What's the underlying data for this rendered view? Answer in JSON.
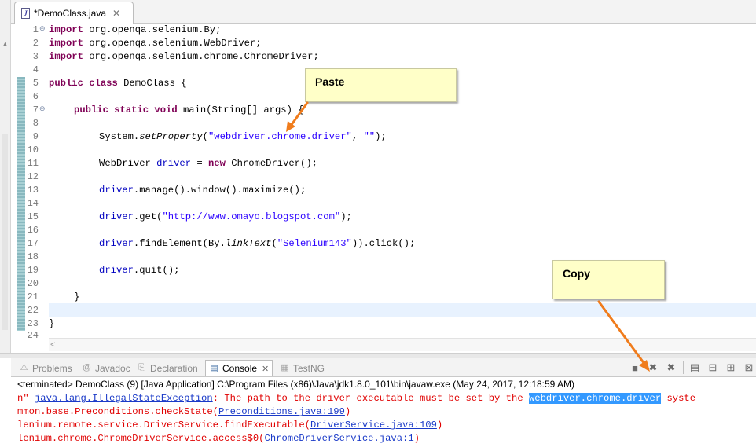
{
  "editor_tab": {
    "label": "*DemoClass.java",
    "close": "✕",
    "file_icon": "J"
  },
  "line_numbers": [
    "1",
    "2",
    "3",
    "4",
    "5",
    "6",
    "7",
    "8",
    "9",
    "10",
    "11",
    "12",
    "13",
    "14",
    "15",
    "16",
    "17",
    "18",
    "19",
    "20",
    "21",
    "22",
    "23",
    "24"
  ],
  "code": {
    "l1_kw": "import",
    "l1_rest": " org.openqa.selenium.By;",
    "l2_kw": "import",
    "l2_rest": " org.openqa.selenium.WebDriver;",
    "l3_kw": "import",
    "l3_rest": " org.openqa.selenium.chrome.ChromeDriver;",
    "l5_kw": "public class",
    "l5_rest": " DemoClass {",
    "l7_kw": "public static void",
    "l7_rest": " main(String[] args) {",
    "l9_a": "System.",
    "l9_method": "setProperty",
    "l9_b": "(",
    "l9_str1": "\"webdriver.chrome.driver\"",
    "l9_c": ", ",
    "l9_str2": "\"\"",
    "l9_d": ");",
    "l11_a": "WebDriver ",
    "l11_var": "driver",
    "l11_b": " = ",
    "l11_kw": "new",
    "l11_c": " ChromeDriver();",
    "l13_var": "driver",
    "l13_rest": ".manage().window().maximize();",
    "l15_var": "driver",
    "l15_a": ".get(",
    "l15_str": "\"http://www.omayo.blogspot.com\"",
    "l15_b": ");",
    "l17_var": "driver",
    "l17_a": ".findElement(By.",
    "l17_method": "linkText",
    "l17_b": "(",
    "l17_str": "\"Selenium143\"",
    "l17_c": ")).click();",
    "l19_var": "driver",
    "l19_rest": ".quit();",
    "l21": "}",
    "l23": "}"
  },
  "view_tabs": [
    {
      "label": "Problems",
      "icon": "problems-icon",
      "glyph": "⚠"
    },
    {
      "label": "Javadoc",
      "icon": "javadoc-icon",
      "glyph": "@"
    },
    {
      "label": "Declaration",
      "icon": "declaration-icon",
      "glyph": "⎘"
    },
    {
      "label": "Console",
      "icon": "console-icon",
      "glyph": "▤",
      "close": "✕"
    },
    {
      "label": "TestNG",
      "icon": "testng-icon",
      "glyph": "▦"
    }
  ],
  "console": {
    "status": "<terminated> DemoClass (9) [Java Application] C:\\Program Files (x86)\\Java\\jdk1.8.0_101\\bin\\javaw.exe (May 24, 2017, 12:18:59 AM)",
    "line1_a": "n\" ",
    "line1_link": "java.lang.IllegalStateException",
    "line1_b": ": The path to the driver executable must be set by the ",
    "line1_sel": "webdriver.chrome.driver",
    "line1_c": " syste",
    "line2_a": "mmon.base.Preconditions.checkState(",
    "line2_link": "Preconditions.java:199",
    "line2_b": ")",
    "line3_a": "lenium.remote.service.DriverService.findExecutable(",
    "line3_link": "DriverService.java:109",
    "line3_b": ")",
    "line4_a": "lenium.chrome.ChromeDriverService.access$0(",
    "line4_link": "ChromeDriverService.java:1",
    "line4_b": ")"
  },
  "callouts": {
    "paste": "Paste",
    "copy": "Copy"
  },
  "colors": {
    "keyword": "#7f0055",
    "string": "#2a00ff",
    "field": "#0000c0",
    "error": "#e00000",
    "arrow": "#f07c1c",
    "callout_bg": "#ffffc8"
  }
}
